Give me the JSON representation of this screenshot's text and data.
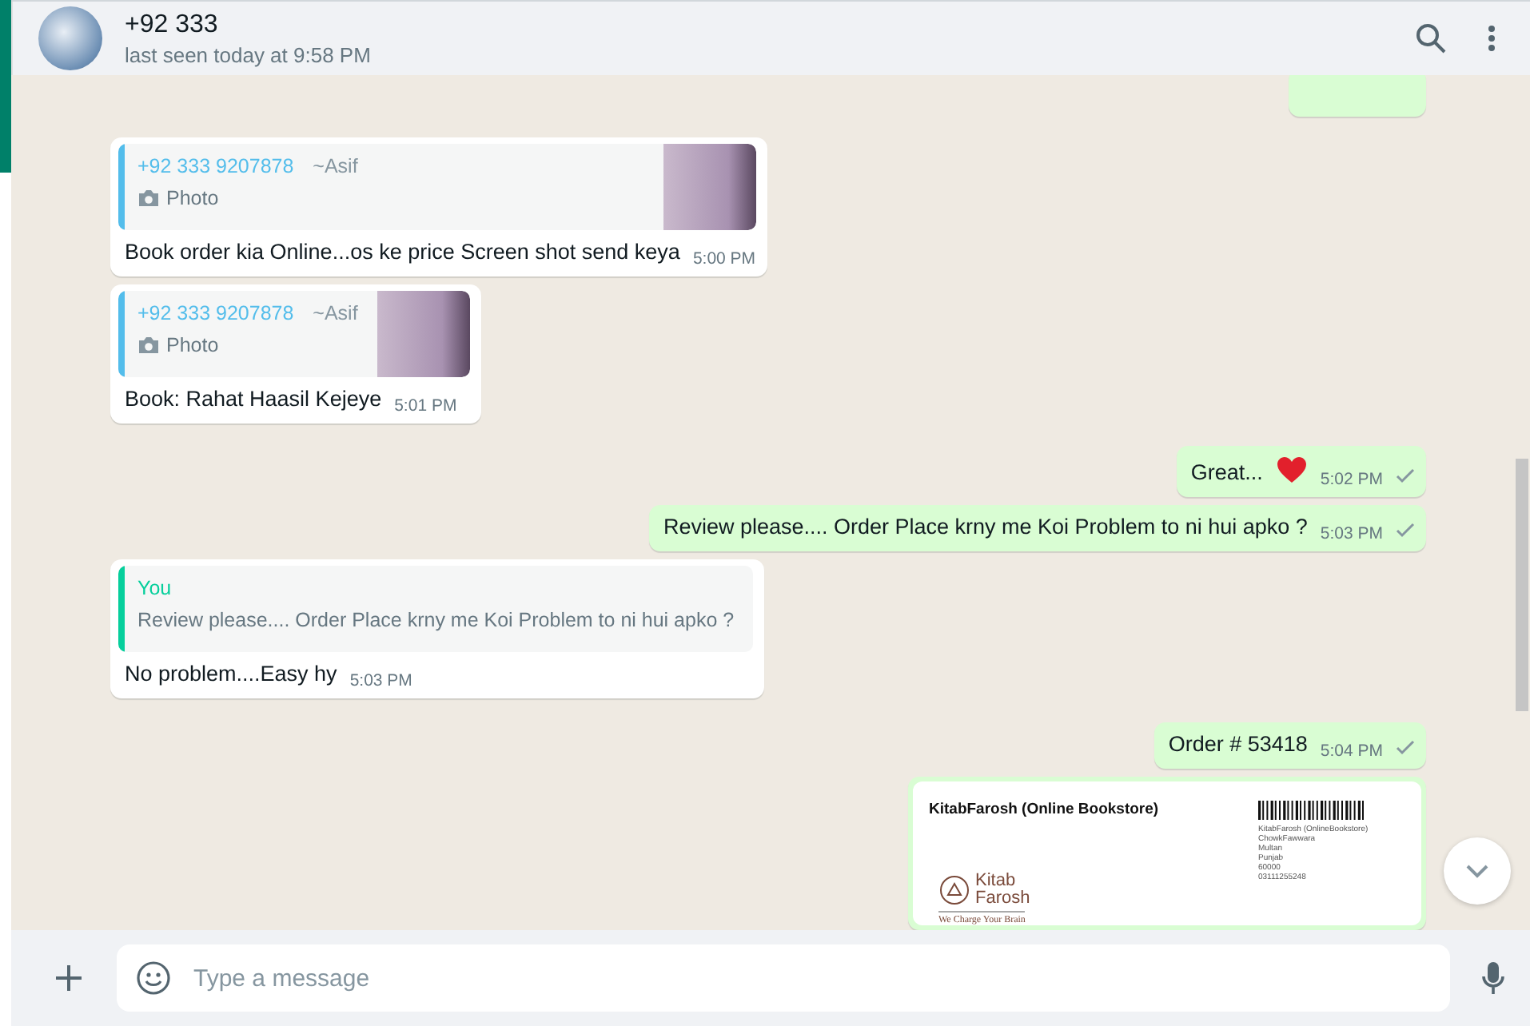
{
  "header": {
    "title": "+92 333",
    "status": "last seen today at 9:58 PM"
  },
  "messages": [
    {
      "kind": "partial",
      "outgoing": true
    },
    {
      "kind": "reply",
      "outgoing": false,
      "quote": {
        "author": "+92 333 9207878",
        "note": "~Asif",
        "photo": true,
        "text": "Photo",
        "color": "#53bdeb"
      },
      "text": "Book order kia Online...os ke price Screen shot send keya",
      "time": "5:00 PM"
    },
    {
      "kind": "reply",
      "outgoing": false,
      "quote": {
        "author": "+92 333 9207878",
        "note": "~Asif",
        "photo": true,
        "text": "Photo",
        "color": "#53bdeb"
      },
      "text": "Book: Rahat Haasil Kejeye",
      "time": "5:01 PM"
    },
    {
      "kind": "text",
      "outgoing": true,
      "text": "Great...",
      "heart": true,
      "time": "5:02 PM",
      "sent": true
    },
    {
      "kind": "text",
      "outgoing": true,
      "text": "Review please.... Order Place krny me Koi Problem to ni hui apko ?",
      "time": "5:03 PM",
      "sent": true
    },
    {
      "kind": "reply",
      "outgoing": false,
      "quote": {
        "author": "You",
        "text": "Review please.... Order Place krny me Koi Problem to ni hui apko ?",
        "color": "#06cf9c"
      },
      "text": "No problem....Easy hy",
      "time": "5:03 PM"
    },
    {
      "kind": "text",
      "outgoing": true,
      "text": "Order # 53418",
      "time": "5:04 PM",
      "sent": true
    },
    {
      "kind": "receipt",
      "outgoing": true,
      "receipt": {
        "store": "KitabFarosh (Online Bookstore)",
        "logo_top": "Kitab",
        "logo_bottom": "Farosh",
        "tagline": "We Charge Your Brain",
        "address": [
          "KitabFarosh (OnlineBookstore)",
          "ChowkFawwara",
          "Multan",
          "Punjab",
          "60000",
          "03111255248"
        ]
      }
    }
  ],
  "composer": {
    "placeholder": "Type a message"
  }
}
